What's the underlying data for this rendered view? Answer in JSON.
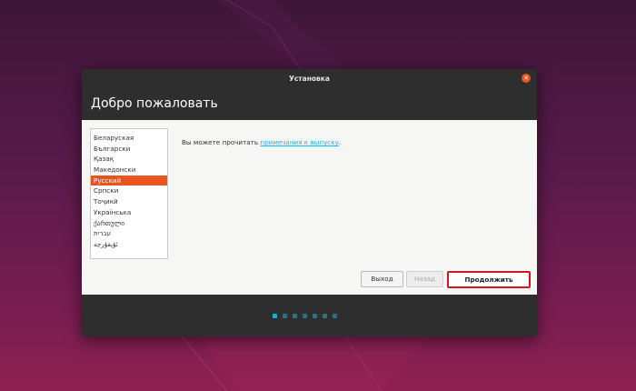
{
  "window": {
    "title": "Установка",
    "close_icon": "close-icon"
  },
  "page": {
    "heading": "Добро пожаловать"
  },
  "languages": {
    "items": [
      "Беларуская",
      "Български",
      "Қазақ",
      "Македонски",
      "Русский",
      "Српски",
      "Тоҷикӣ",
      "Українська",
      "ქართული",
      "עברית",
      "ئۇيغۇرچە"
    ],
    "selected": "Русский"
  },
  "release_notes": {
    "prefix": "Вы можете прочитать ",
    "link": "примечания к выпуску",
    "suffix": "."
  },
  "buttons": {
    "quit": "Выход",
    "back": "Назад",
    "continue": "Продолжить"
  },
  "progress": {
    "total_steps": 7,
    "current_step": 1
  },
  "colors": {
    "accent": "#e95420",
    "link": "#19b6ee",
    "highlight_border": "#d6121f"
  }
}
